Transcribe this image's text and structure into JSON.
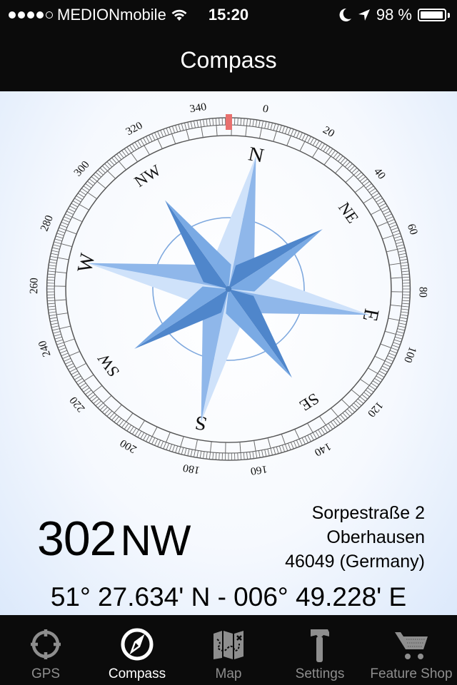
{
  "status_bar": {
    "signal_bars_filled": 4,
    "signal_bars_total": 5,
    "carrier": "MEDIONmobile",
    "wifi_icon": "wifi-icon",
    "time": "15:20",
    "do_not_disturb_icon": "moon-icon",
    "location_icon": "location-arrow-icon",
    "battery_percent_label": "98 %",
    "battery_level": 0.98
  },
  "nav": {
    "title": "Compass"
  },
  "compass": {
    "heading_degrees": 302,
    "cardinal_labels": [
      "N",
      "NE",
      "E",
      "SE",
      "S",
      "SW",
      "W",
      "NW"
    ],
    "degree_labels": [
      "0",
      "20",
      "40",
      "60",
      "80",
      "100",
      "120",
      "140",
      "160",
      "180",
      "200",
      "220",
      "240",
      "260",
      "280",
      "300",
      "320",
      "340"
    ],
    "marker_color": "#e8706e",
    "rose_color": "#5b93d8"
  },
  "readout": {
    "heading_value": "302",
    "heading_direction": "NW",
    "address_line1": "Sorpestraße 2",
    "address_line2": "Oberhausen",
    "address_line3": "46049 (Germany)",
    "coordinates": "51° 27.634' N - 006° 49.228' E"
  },
  "tabs": [
    {
      "label": "GPS",
      "icon": "crosshair-icon",
      "active": false
    },
    {
      "label": "Compass",
      "icon": "compass-icon",
      "active": true
    },
    {
      "label": "Map",
      "icon": "map-icon",
      "active": false
    },
    {
      "label": "Settings",
      "icon": "hammer-icon",
      "active": false
    },
    {
      "label": "Feature Shop",
      "icon": "cart-icon",
      "active": false
    }
  ]
}
